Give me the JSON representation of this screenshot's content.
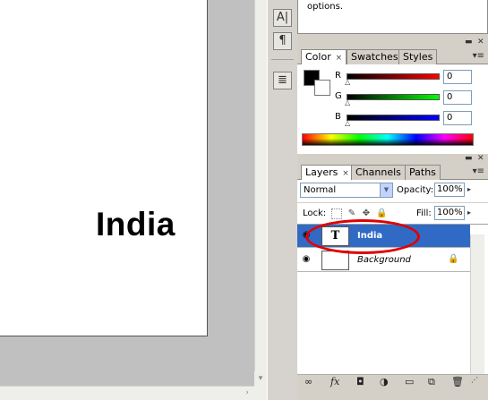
{
  "document": {
    "text": "India"
  },
  "info_panel": {
    "text": "options."
  },
  "tool_strip": {
    "icons": [
      "character-icon",
      "paragraph-icon",
      "notes-icon"
    ]
  },
  "color_panel": {
    "tabs": [
      {
        "label": "Color",
        "closable": true,
        "active": true
      },
      {
        "label": "Swatches",
        "active": false
      },
      {
        "label": "Styles",
        "active": false
      }
    ],
    "channels": [
      {
        "label": "R",
        "value": "0"
      },
      {
        "label": "G",
        "value": "0"
      },
      {
        "label": "B",
        "value": "0"
      }
    ],
    "foreground_color": "#000000",
    "background_color": "#ffffff"
  },
  "layers_panel": {
    "tabs": [
      {
        "label": "Layers",
        "closable": true,
        "active": true
      },
      {
        "label": "Channels",
        "active": false
      },
      {
        "label": "Paths",
        "active": false
      }
    ],
    "blend_mode": "Normal",
    "opacity_label": "Opacity:",
    "opacity_value": "100%",
    "lock_label": "Lock:",
    "fill_label": "Fill:",
    "fill_value": "100%",
    "layers": [
      {
        "name": "India",
        "type": "text",
        "selected": true,
        "thumb_glyph": "T"
      },
      {
        "name": "Background",
        "type": "image",
        "selected": false,
        "locked": true
      }
    ]
  },
  "colors": {
    "selection": "#316ac5",
    "highlight_oval": "#e00000"
  }
}
